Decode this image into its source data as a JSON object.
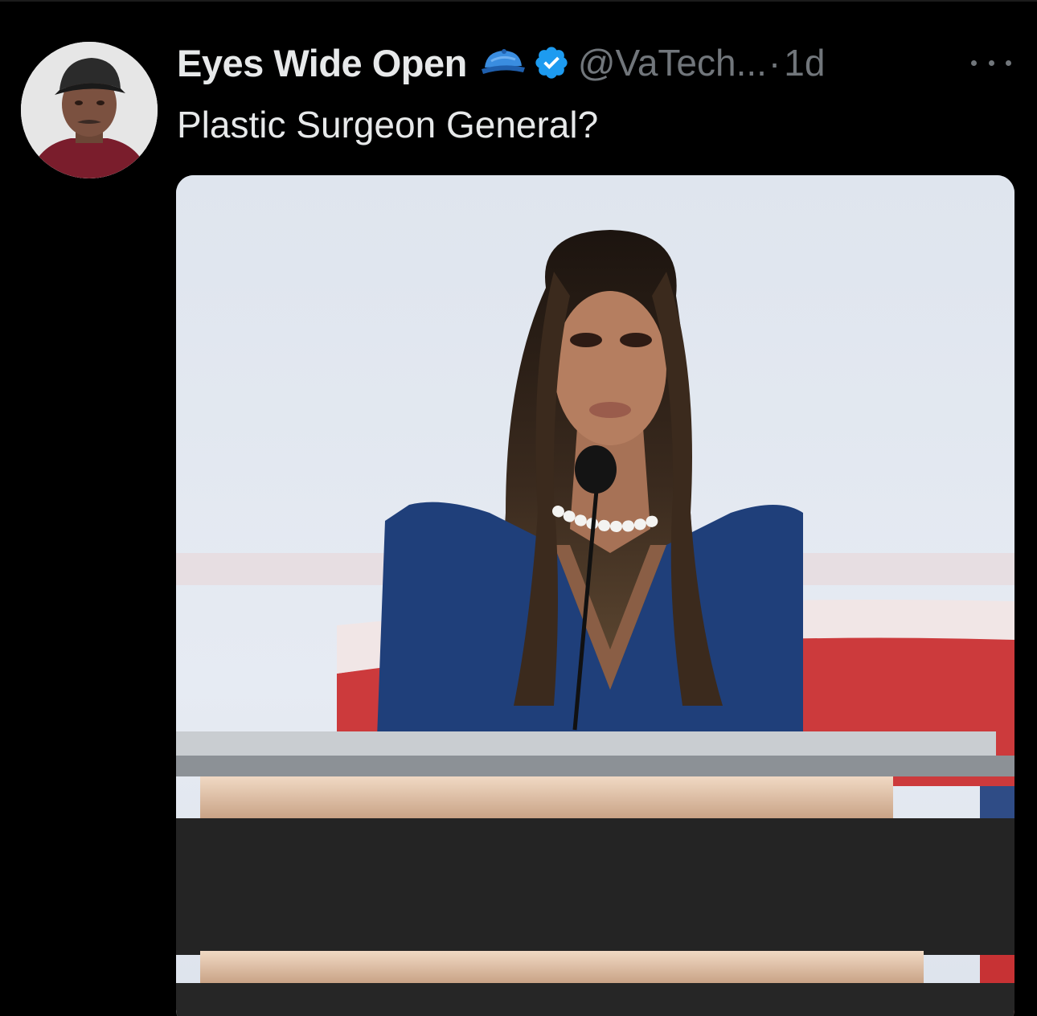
{
  "tweet": {
    "display_name": "Eyes Wide Open",
    "handle": "@VaTech...",
    "separator": "·",
    "time": "1d",
    "text": "Plastic Surgeon General?"
  },
  "icons": {
    "badge_emoji": "blue-cap-icon",
    "verified": "verified-badge-icon",
    "more": "more-options-icon"
  },
  "colors": {
    "background": "#000000",
    "primary_text": "#e7e9ea",
    "secondary_text": "#71767b",
    "verified_blue": "#1d9bf0"
  }
}
